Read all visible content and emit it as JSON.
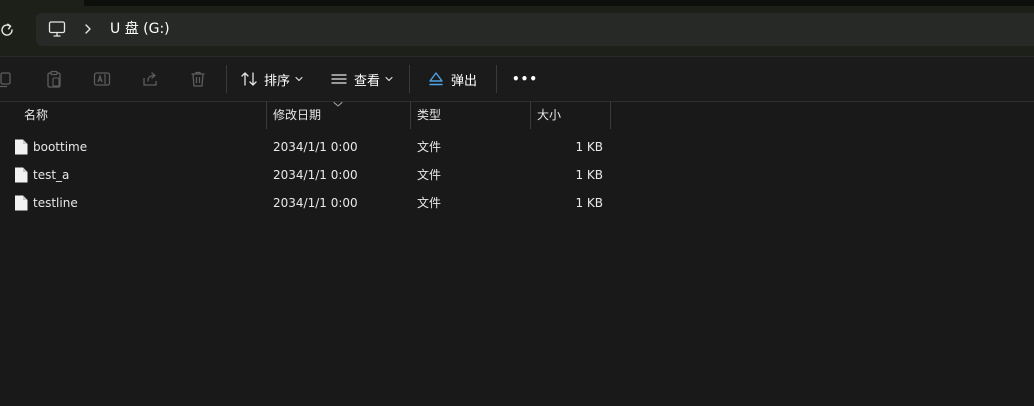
{
  "address_bar": {
    "drive": "U 盘 (G:)"
  },
  "toolbar": {
    "sort_label": "排序",
    "view_label": "查看",
    "eject_label": "弹出",
    "more_label": "•••"
  },
  "columns": [
    "名称",
    "修改日期",
    "类型",
    "大小"
  ],
  "files": [
    {
      "name": "boottime",
      "modified": "2034/1/1 0:00",
      "type": "文件",
      "size": "1 KB"
    },
    {
      "name": "test_a",
      "modified": "2034/1/1 0:00",
      "type": "文件",
      "size": "1 KB"
    },
    {
      "name": "testline",
      "modified": "2034/1/1 0:00",
      "type": "文件",
      "size": "1 KB"
    }
  ],
  "colors": {
    "background": "#191919",
    "address_region": "#1c2019",
    "address_box": "#262925",
    "eject_accent": "#4ca3e6"
  }
}
